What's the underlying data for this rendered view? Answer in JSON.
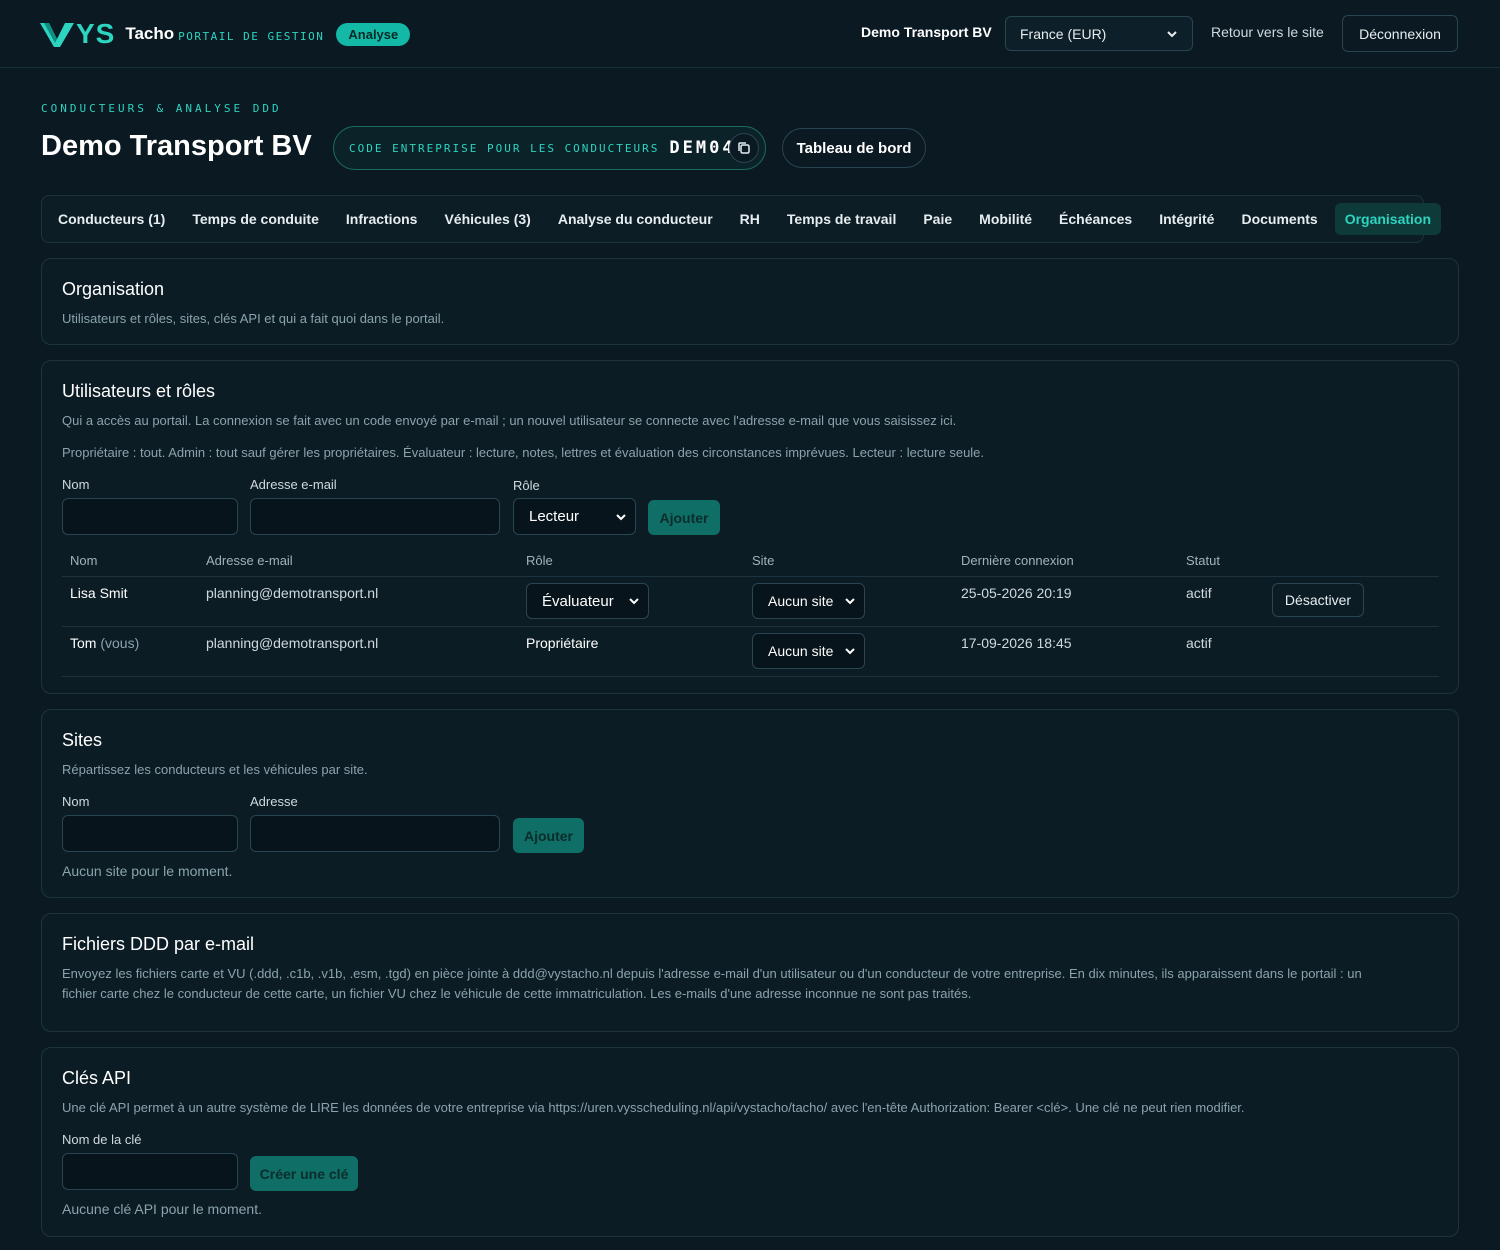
{
  "header": {
    "logo_text": "YS",
    "brand": "Tacho",
    "brand_sub": "PORTAIL DE GESTION",
    "badge": "Analyse",
    "company": "Demo Transport BV",
    "country_select": "France (EUR)",
    "back_link": "Retour vers le site",
    "logout": "Déconnexion"
  },
  "page": {
    "eyebrow": "CONDUCTEURS & ANALYSE DDD",
    "title": "Demo Transport BV",
    "code_label": "CODE ENTREPRISE POUR LES CONDUCTEURS",
    "code_value": "DEM042",
    "dashboard_button": "Tableau de bord"
  },
  "tabs": [
    {
      "label": "Conducteurs (1)",
      "active": false
    },
    {
      "label": "Temps de conduite",
      "active": false
    },
    {
      "label": "Infractions",
      "active": false
    },
    {
      "label": "Véhicules (3)",
      "active": false
    },
    {
      "label": "Analyse du conducteur",
      "active": false
    },
    {
      "label": "RH",
      "active": false
    },
    {
      "label": "Temps de travail",
      "active": false
    },
    {
      "label": "Paie",
      "active": false
    },
    {
      "label": "Mobilité",
      "active": false
    },
    {
      "label": "Échéances",
      "active": false
    },
    {
      "label": "Intégrité",
      "active": false
    },
    {
      "label": "Documents",
      "active": false
    },
    {
      "label": "Organisation",
      "active": true
    }
  ],
  "organisation": {
    "title": "Organisation",
    "desc": "Utilisateurs et rôles, sites, clés API et qui a fait quoi dans le portail."
  },
  "users": {
    "title": "Utilisateurs et rôles",
    "desc1": "Qui a accès au portail. La connexion se fait avec un code envoyé par e-mail ; un nouvel utilisateur se connecte avec l'adresse e-mail que vous saisissez ici.",
    "desc2": "Propriétaire : tout. Admin : tout sauf gérer les propriétaires. Évaluateur : lecture, notes, lettres et évaluation des circonstances imprévues. Lecteur : lecture seule.",
    "form": {
      "name_label": "Nom",
      "email_label": "Adresse e-mail",
      "role_label": "Rôle",
      "role_value": "Lecteur",
      "add_button": "Ajouter"
    },
    "columns": [
      "Nom",
      "Adresse e-mail",
      "Rôle",
      "Site",
      "Dernière connexion",
      "Statut"
    ],
    "rows": [
      {
        "name": "Lisa Smit",
        "suffix": "",
        "email": "planning@demotransport.nl",
        "role": "Évaluateur",
        "site": "Aucun site",
        "last_login": "25-05-2026 20:19",
        "status": "actif",
        "action": "Désactiver"
      },
      {
        "name": "Tom",
        "suffix": "(vous)",
        "email": "planning@demotransport.nl",
        "role": "Propriétaire",
        "site": "Aucun site",
        "last_login": "17-09-2026 18:45",
        "status": "actif",
        "action": ""
      }
    ]
  },
  "sites": {
    "title": "Sites",
    "desc": "Répartissez les conducteurs et les véhicules par site.",
    "name_label": "Nom",
    "address_label": "Adresse",
    "add_button": "Ajouter",
    "empty": "Aucun site pour le moment."
  },
  "ddd_mail": {
    "title": "Fichiers DDD par e-mail",
    "desc_line1": "Envoyez les fichiers carte et VU (.ddd, .c1b, .v1b, .esm, .tgd) en pièce jointe à ddd@vystacho.nl depuis l'adresse e-mail d'un utilisateur ou d'un conducteur de votre entreprise. En dix minutes, ils apparaissent dans le portail : un",
    "desc_line2": "fichier carte chez le conducteur de cette carte, un fichier VU chez le véhicule de cette immatriculation. Les e-mails d'une adresse inconnue ne sont pas traités."
  },
  "api_keys": {
    "title": "Clés API",
    "desc": "Une clé API permet à un autre système de LIRE les données de votre entreprise via https://uren.vysscheduling.nl/api/vystacho/tacho/ avec l'en-tête Authorization: Bearer <clé>. Une clé ne peut rien modifier.",
    "key_label": "Nom de la clé",
    "create_button": "Créer une clé",
    "empty": "Aucune clé API pour le moment."
  },
  "colors": {
    "accent": "#2dd4bf",
    "background": "#0b1922",
    "card": "#0c1c25",
    "button_teal": "#0f6e66"
  }
}
